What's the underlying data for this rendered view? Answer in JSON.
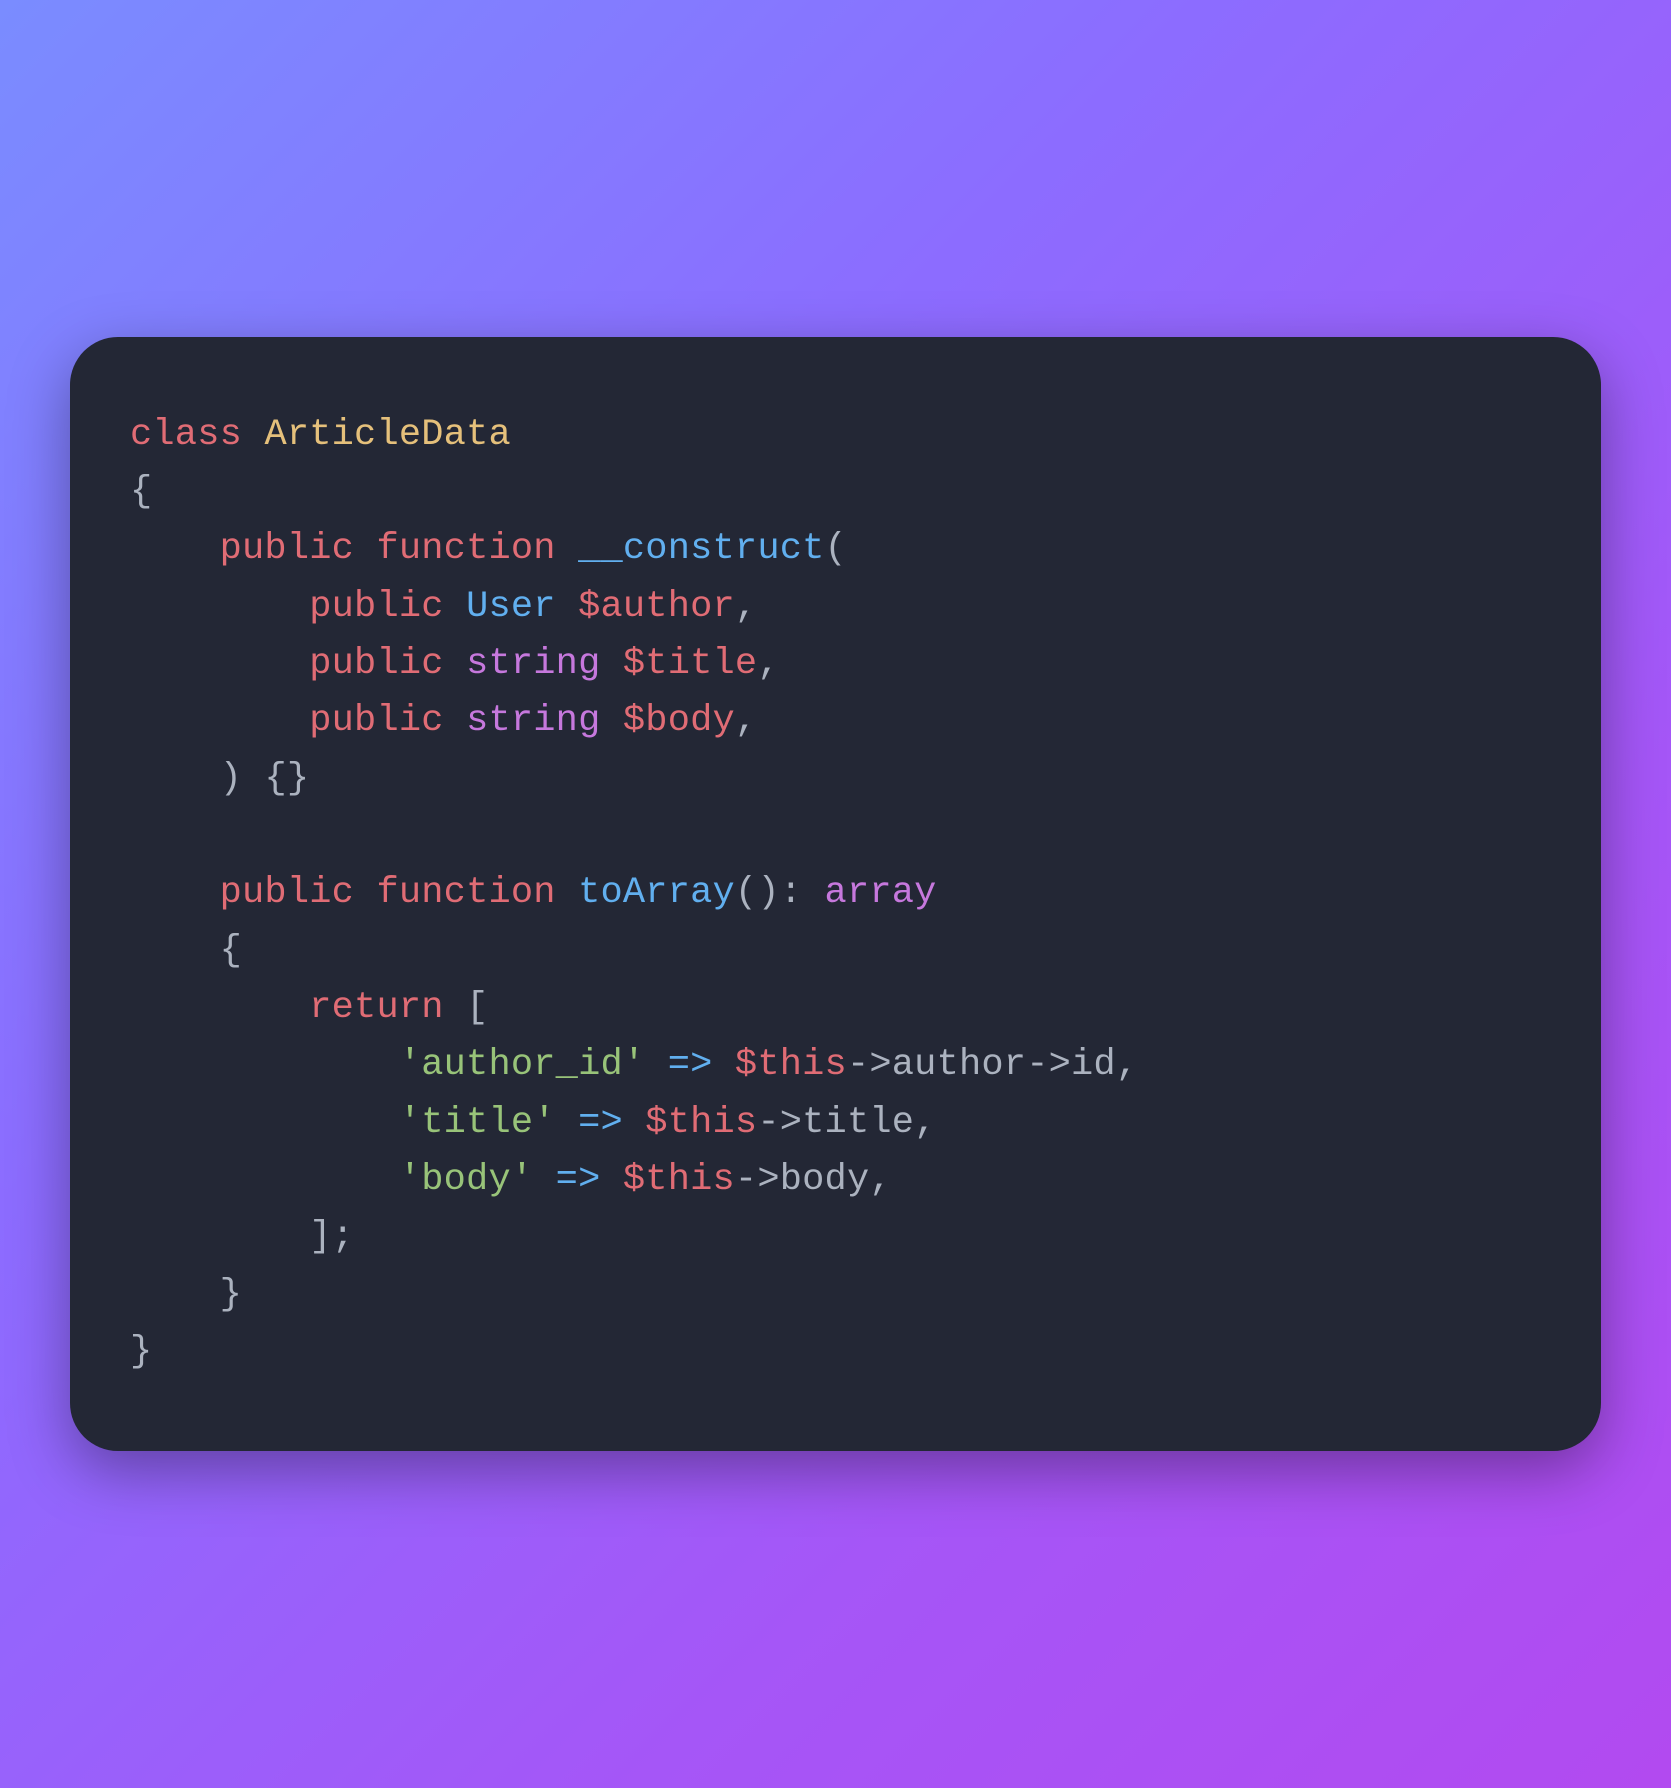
{
  "colors": {
    "bg_gradient_start": "#7a8cff",
    "bg_gradient_end": "#b24af0",
    "card_bg": "#232735",
    "keyword": "#e06c75",
    "classname": "#e5c07b",
    "type": "#61afef",
    "type_keyword": "#c678dd",
    "variable": "#e06c75",
    "punct": "#abb2bf",
    "string": "#98c379",
    "arrow": "#61afef"
  },
  "code": {
    "kw_class": "class",
    "classname": "ArticleData",
    "brace_open": "{",
    "brace_close": "}",
    "kw_public1": "public",
    "kw_function1": "function",
    "fn_construct": "__construct",
    "paren_open": "(",
    "paren_close": ")",
    "param1_public": "public",
    "param1_type": "User",
    "param1_var": "$author",
    "comma": ",",
    "param2_public": "public",
    "param2_type": "string",
    "param2_var": "$title",
    "param3_public": "public",
    "param3_type": "string",
    "param3_var": "$body",
    "empty_braces": "{}",
    "kw_public2": "public",
    "kw_function2": "function",
    "fn_toarray": "toArray",
    "parens_empty": "()",
    "colon": ":",
    "ret_type": "array",
    "kw_return": "return",
    "bracket_open": "[",
    "bracket_close": "]",
    "semi": ";",
    "str_author_id": "'author_id'",
    "fat_arrow": "=>",
    "var_this1": "$this",
    "thin_arrow": "->",
    "prop_author": "author",
    "prop_id": "id",
    "str_title": "'title'",
    "var_this2": "$this",
    "prop_title": "title",
    "str_body": "'body'",
    "var_this3": "$this",
    "prop_body": "body"
  }
}
